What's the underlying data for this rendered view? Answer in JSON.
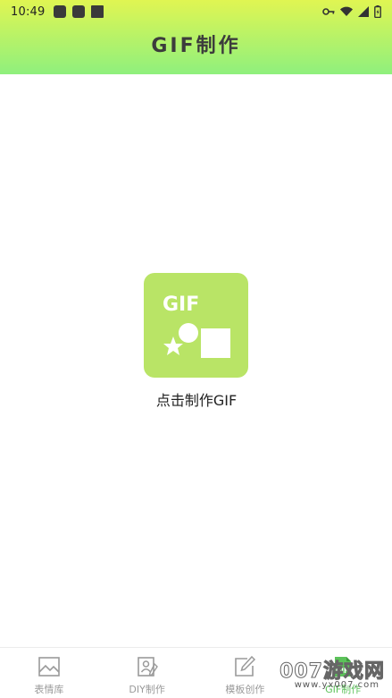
{
  "status_bar": {
    "time": "10:49"
  },
  "header": {
    "title": "GIF制作"
  },
  "center_action": {
    "icon_text": "GIF",
    "label": "点击制作GIF"
  },
  "tabs": [
    {
      "label": "表情库",
      "icon": "image-icon",
      "active": false
    },
    {
      "label": "DIY制作",
      "icon": "edit-portrait-icon",
      "active": false
    },
    {
      "label": "模板创作",
      "icon": "edit-note-icon",
      "active": false
    },
    {
      "label": "GIF制作",
      "icon": "gif-file-icon",
      "active": true,
      "icon_text": "GIF"
    }
  ],
  "watermark": {
    "main": "007游戏网",
    "url": "www.yx007.com"
  },
  "colors": {
    "header_top": "#e0f552",
    "header_bottom": "#8ff07d",
    "accent": "#b9e466",
    "active_tab": "#5cc25a",
    "inactive_tab": "#9a9a9a"
  }
}
